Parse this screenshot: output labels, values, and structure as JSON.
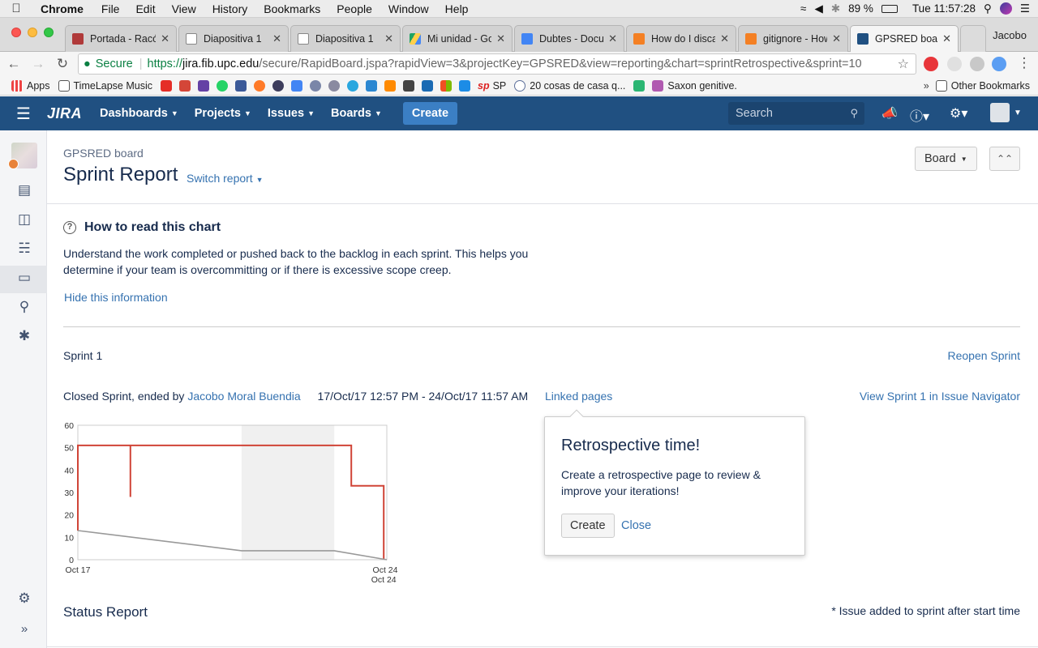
{
  "mac_menu": {
    "app_name": "Chrome",
    "items": [
      "File",
      "Edit",
      "View",
      "History",
      "Bookmarks",
      "People",
      "Window",
      "Help"
    ],
    "battery": "89 %",
    "clock": "Tue 11:57:28"
  },
  "tabs": [
    {
      "label": "Portada - Racó",
      "favicon_color": "#b03a3a"
    },
    {
      "label": "Diapositiva 1",
      "favicon_color": "#999999"
    },
    {
      "label": "Diapositiva 1",
      "favicon_color": "#999999"
    },
    {
      "label": "Mi unidad - Google Drive",
      "favicon_color": "#1fa463"
    },
    {
      "label": "Dubtes - Documentos",
      "favicon_color": "#4285f4"
    },
    {
      "label": "How do I discard",
      "favicon_color": "#f48024"
    },
    {
      "label": "gitignore - How",
      "favicon_color": "#f48024"
    },
    {
      "label": "GPSRED board",
      "favicon_color": "#205081",
      "active": true
    }
  ],
  "profile_name": "Jacobo",
  "address_bar": {
    "secure_label": "Secure",
    "url_scheme": "https://",
    "url_host": "jira.fib.upc.edu",
    "url_path": "/secure/RapidBoard.jspa?rapidView=3&projectKey=GPSRED&view=reporting&chart=sprintRetrospective&sprint=10"
  },
  "bookmarks": {
    "apps": "Apps",
    "timelapse": "TimeLapse Music",
    "sp": "SP",
    "cosas": "20 cosas de casa q...",
    "saxon": "Saxon genitive.",
    "other": "Other Bookmarks"
  },
  "jira_header": {
    "logo": "JIRA",
    "nav": [
      "Dashboards",
      "Projects",
      "Issues",
      "Boards"
    ],
    "create": "Create",
    "search_placeholder": "Search"
  },
  "page": {
    "board_name": "GPSRED board",
    "title": "Sprint Report",
    "switch_report": "Switch report",
    "board_button": "Board",
    "help_title": "How to read this chart",
    "help_text": "Understand the work completed or pushed back to the backlog in each sprint. This helps you determine if your team is overcommitting or if there is excessive scope creep.",
    "hide_info": "Hide this information",
    "sprint_name": "Sprint 1",
    "reopen": "Reopen Sprint",
    "closed_by_prefix": "Closed Sprint, ended by",
    "closed_by_user": "Jacobo Moral Buendia",
    "date_range": "17/Oct/17 12:57 PM - 24/Oct/17 11:57 AM",
    "linked_pages": "Linked pages",
    "view_sprint": "View Sprint 1 in Issue Navigator",
    "status_report": "Status Report",
    "issue_note": "* Issue added to sprint after start time"
  },
  "popup": {
    "title": "Retrospective time!",
    "text": "Create a retrospective page to review & improve your iterations!",
    "create": "Create",
    "close": "Close"
  },
  "chart_data": {
    "type": "line",
    "y_ticks": [
      0,
      10,
      20,
      30,
      40,
      50,
      60
    ],
    "ylim": [
      0,
      60
    ],
    "x_labels": [
      "Oct 17",
      "Oct 24",
      "Oct 24"
    ],
    "colors": {
      "remaining": "#d04437",
      "guideline": "#999999",
      "nonworking": "#f0f0f0"
    },
    "series": [
      {
        "color": "#d04437",
        "points": [
          [
            0,
            13
          ],
          [
            0,
            51
          ],
          [
            0.17,
            51
          ],
          [
            0.17,
            28
          ],
          [
            0.17,
            51
          ],
          [
            0.885,
            51
          ],
          [
            0.885,
            33
          ],
          [
            0.99,
            33
          ],
          [
            0.99,
            0
          ]
        ]
      },
      {
        "color": "#999999",
        "points": [
          [
            0,
            13
          ],
          [
            0.53,
            4
          ],
          [
            0.83,
            4
          ],
          [
            1,
            0
          ]
        ]
      }
    ],
    "nonworking_span": [
      0.53,
      0.83
    ]
  }
}
